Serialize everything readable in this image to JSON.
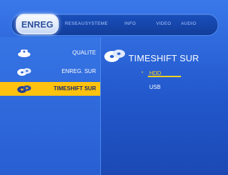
{
  "header": {
    "active_tab": "ENREG",
    "tabs": [
      "RESEAU",
      "SYSTEME",
      "INFO",
      "VIDEO",
      "AUDIO"
    ]
  },
  "sidebar": {
    "items": [
      {
        "label": "QUALITE",
        "icon": "quality-disc-icon",
        "selected": false
      },
      {
        "label": "ENREG. SUR",
        "icon": "record-disc-icon",
        "selected": false
      },
      {
        "label": "TIMESHIFT SUR",
        "icon": "timeshift-disc-icon",
        "selected": true
      }
    ]
  },
  "content": {
    "title": "TIMESHIFT SUR",
    "options": [
      {
        "label": "HDD",
        "selected": true
      },
      {
        "label": "USB",
        "selected": false
      }
    ]
  },
  "colors": {
    "background": "#2058c8",
    "accent": "#ffc20e",
    "selected_text": "#ffd21a"
  }
}
